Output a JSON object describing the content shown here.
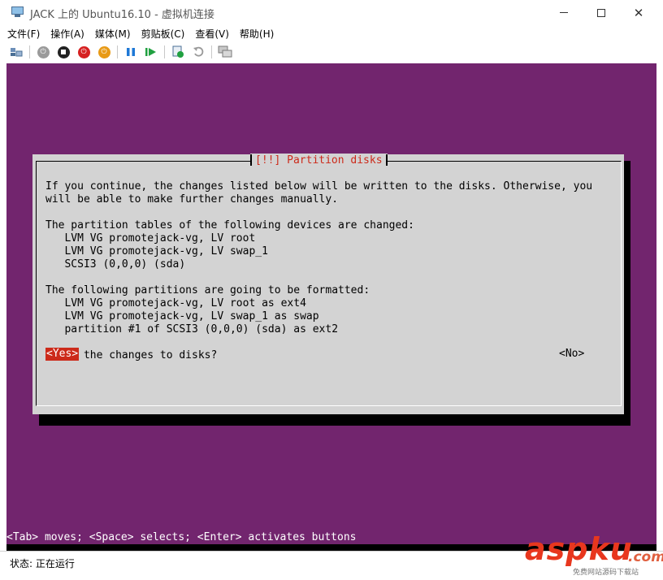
{
  "window": {
    "title": "JACK 上的 Ubuntu16.10 - 虚拟机连接",
    "controls": {
      "minimize": "",
      "maximize": "",
      "close": "✕"
    }
  },
  "menu": [
    "文件(F)",
    "操作(A)",
    "媒体(M)",
    "剪贴板(C)",
    "查看(V)",
    "帮助(H)"
  ],
  "toolbar": {
    "icons": [
      "ctrl-alt-del-icon",
      "start-icon",
      "turn-off-icon",
      "shutdown-icon",
      "save-icon",
      "pause-icon",
      "reset-icon",
      "checkpoint-icon",
      "revert-icon",
      "enhanced-session-icon"
    ]
  },
  "dialog": {
    "title": "[!!] Partition disks",
    "lines": [
      "If you continue, the changes listed below will be written to the disks. Otherwise, you",
      "will be able to make further changes manually.",
      "",
      "The partition tables of the following devices are changed:",
      "   LVM VG promotejack-vg, LV root",
      "   LVM VG promotejack-vg, LV swap_1",
      "   SCSI3 (0,0,0) (sda)",
      "",
      "The following partitions are going to be formatted:",
      "   LVM VG promotejack-vg, LV root as ext4",
      "   LVM VG promotejack-vg, LV swap_1 as swap",
      "   partition #1 of SCSI3 (0,0,0) (sda) as ext2",
      "",
      "Write the changes to disks?"
    ],
    "yes_label": "<Yes>",
    "no_label": "<No>"
  },
  "console": {
    "hint": "<Tab> moves; <Space> selects; <Enter> activates buttons"
  },
  "statusbar": {
    "text": "状态: 正在运行"
  },
  "watermark": {
    "brand": "aspku",
    "tld": ".com",
    "sub": "免费网站源码下载站"
  },
  "colors": {
    "console_bg": "#72256e",
    "dialog_bg": "#d3d3d3",
    "dialog_title": "#cc2a1a",
    "selected_button_bg": "#cc2a1a"
  }
}
